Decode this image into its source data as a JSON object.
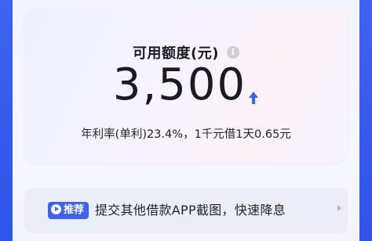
{
  "credit": {
    "title": "可用额度(元)",
    "info_icon": "info-icon",
    "amount": "3,500",
    "trend_icon": "up-arrow-icon",
    "rate_prefix": "年利率(单利)",
    "rate_value": "23.4%",
    "rate_suffix": "，1千元借1天0.65元"
  },
  "promo": {
    "badge_label": "推荐",
    "badge_icon": "play-icon",
    "text": "提交其他借款APP截图，快速降息",
    "chevron_icon": "chevron-right-icon"
  },
  "colors": {
    "accent": "#3b63ee",
    "side_border": "#2f55e9"
  }
}
